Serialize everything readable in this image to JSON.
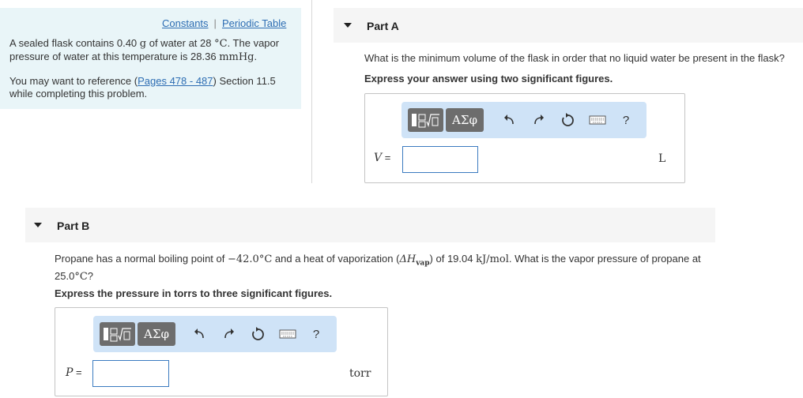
{
  "info": {
    "links": {
      "constants": "Constants",
      "separator": "|",
      "periodic_table": "Periodic Table"
    },
    "text_part1": "A sealed flask contains 0.40 ",
    "text_g": "g",
    "text_part2": " of water at 28 ",
    "text_deg": "°C",
    "text_part3": ". The vapor pressure of water at this temperature is 28.36 ",
    "text_mmhg": "mmHg",
    "text_part4": ".",
    "ref_prefix": "You may want to reference (",
    "ref_link": "Pages 478 - 487",
    "ref_suffix": ") Section 11.5 while completing this problem."
  },
  "part_a": {
    "title": "Part A",
    "question": "What is the minimum volume of the flask in order that no liquid water be present in the flask?",
    "instruction": "Express your answer using two significant figures.",
    "variable": "V",
    "equals": "=",
    "value": "",
    "unit": "L"
  },
  "part_b": {
    "title": "Part B",
    "question_1": "Propane has a normal boiling point of ",
    "bp_value": "−42.0",
    "bp_unit": "°C",
    "question_2": " and a heat of vaporization (",
    "delta_h": "ΔH",
    "sub_vap": "vap",
    "question_3": ") of 19.04 ",
    "hv_unit": "kJ/mol",
    "question_4": ". What is the vapor pressure of propane at",
    "temp_value": "25.0",
    "temp_unit": "°C",
    "question_5": "?",
    "instruction": "Express the pressure in torrs to three significant figures.",
    "variable": "P",
    "equals": "=",
    "value": "",
    "unit": "torr"
  },
  "toolbar": {
    "greek_label": "ΑΣφ",
    "help_label": "?",
    "icons": [
      "templates-icon",
      "greek-symbols-icon",
      "undo-icon",
      "redo-icon",
      "reset-icon",
      "keyboard-icon",
      "help-icon"
    ]
  },
  "colors": {
    "link": "#2d6db3",
    "info_bg": "#e9f5f8",
    "toolbar_bg": "#cfe3f7",
    "input_border": "#3b7bc0",
    "button_gray": "#6d6d6d"
  }
}
